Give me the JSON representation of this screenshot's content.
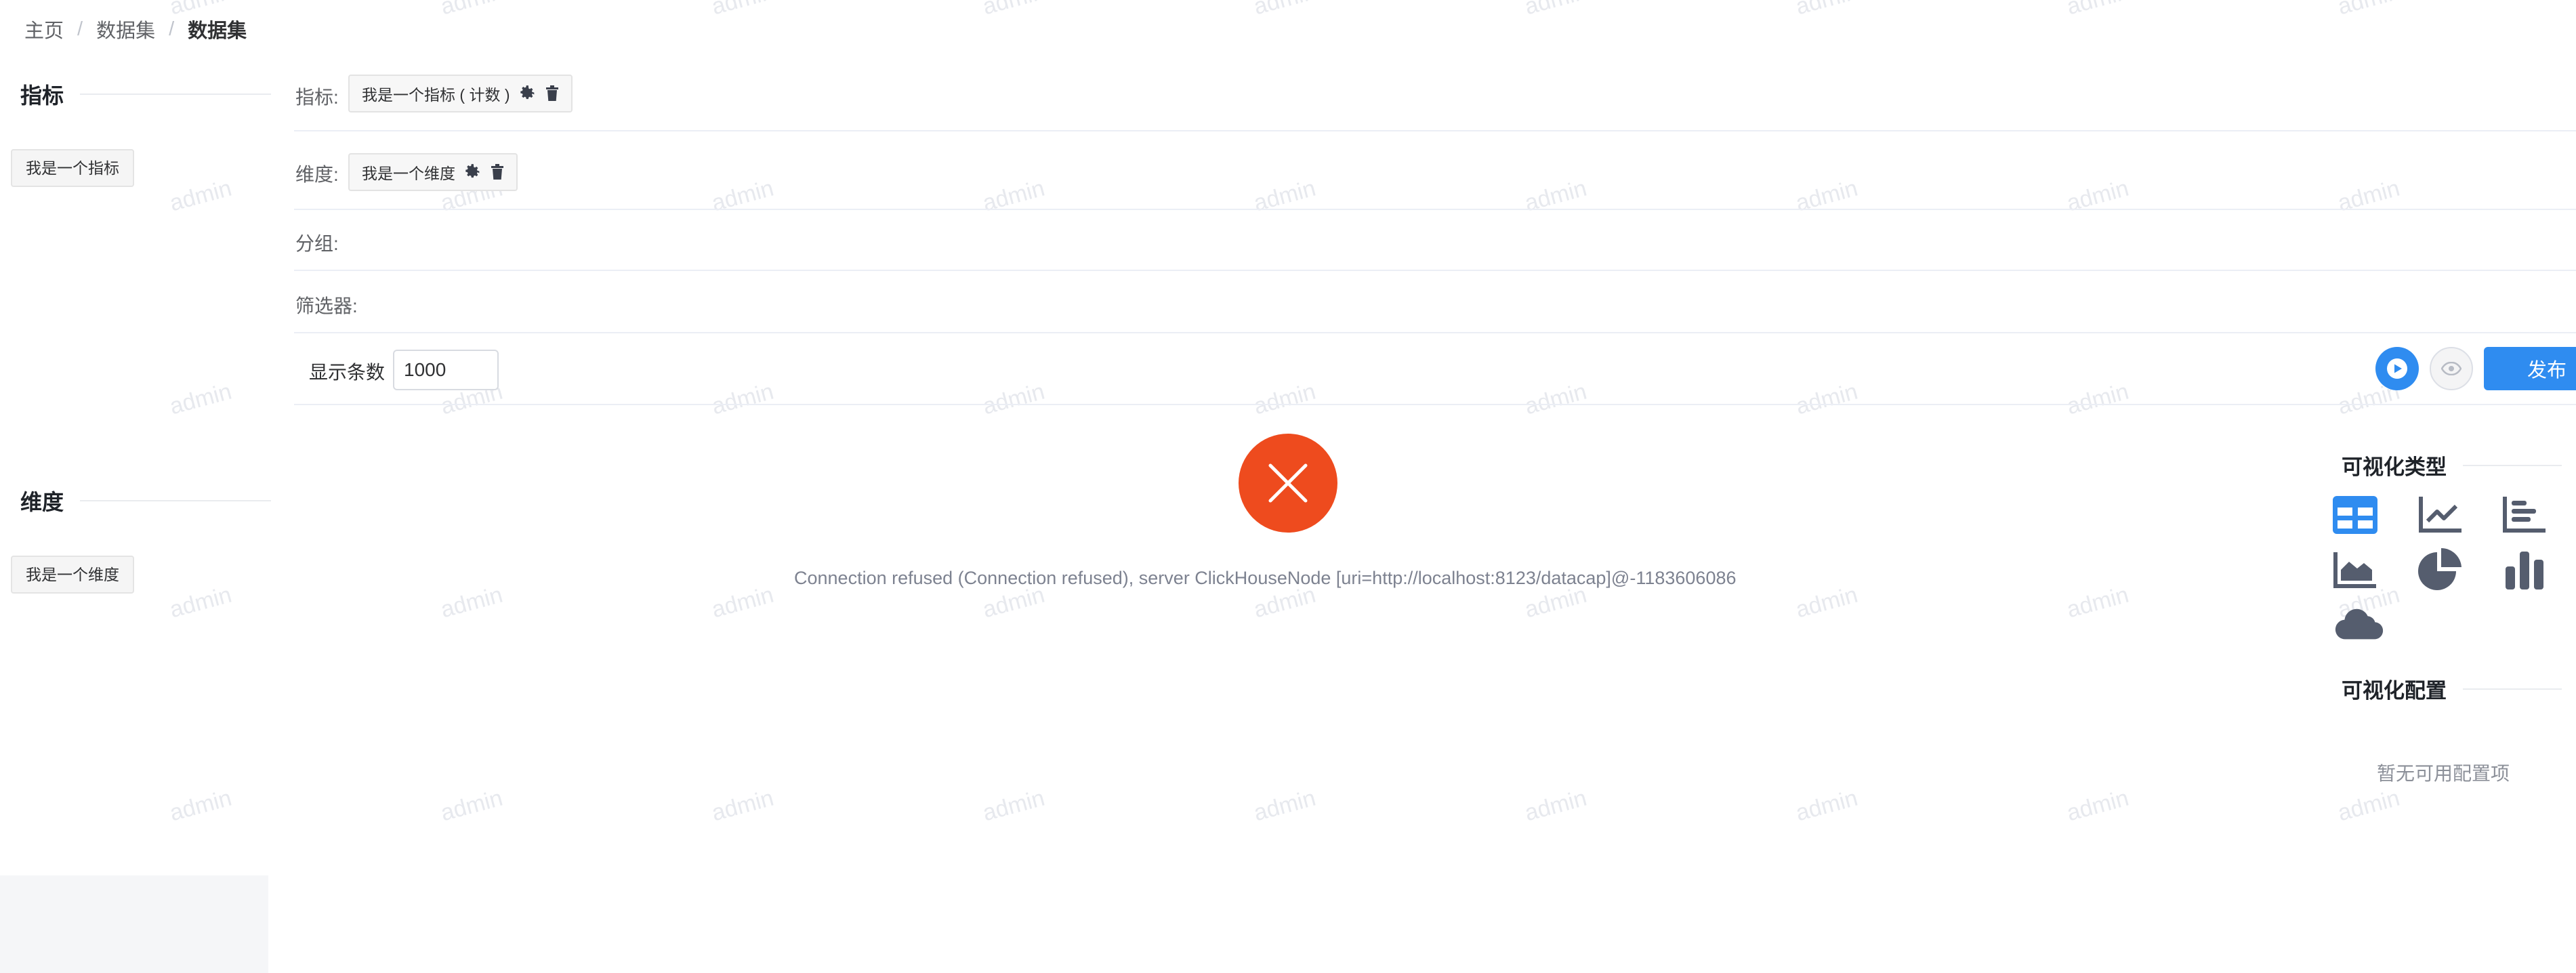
{
  "breadcrumb": {
    "home": "主页",
    "datasets": "数据集",
    "current": "数据集"
  },
  "sidebar": {
    "metrics_title": "指标",
    "metric_item": "我是一个指标",
    "dimensions_title": "维度",
    "dimension_item": "我是一个维度"
  },
  "query": {
    "metrics_label": "指标:",
    "metric_chip": "我是一个指标 ( 计数 )",
    "dimensions_label": "维度:",
    "dimension_chip": "我是一个维度",
    "group_label": "分组:",
    "filter_label": "筛选器:",
    "limit_label": "显示条数",
    "limit_value": "1000"
  },
  "toolbar": {
    "publish_label": "发布"
  },
  "result": {
    "error_message": "Connection refused (Connection refused), server ClickHouseNode [uri=http://localhost:8123/datacap]@-1183606086"
  },
  "visualization": {
    "type_title": "可视化类型",
    "config_title": "可视化配置",
    "empty_config": "暂无可用配置项",
    "types": [
      "table-icon",
      "line-chart-icon",
      "bar-horizontal-icon",
      "area-chart-icon",
      "pie-chart-icon",
      "bar-chart-icon",
      "word-cloud-icon"
    ],
    "selected": "table-icon"
  },
  "watermark": "admin",
  "colors": {
    "accent": "#2f8cf0",
    "error": "#ee4b1e",
    "icon": "#555d6e"
  }
}
